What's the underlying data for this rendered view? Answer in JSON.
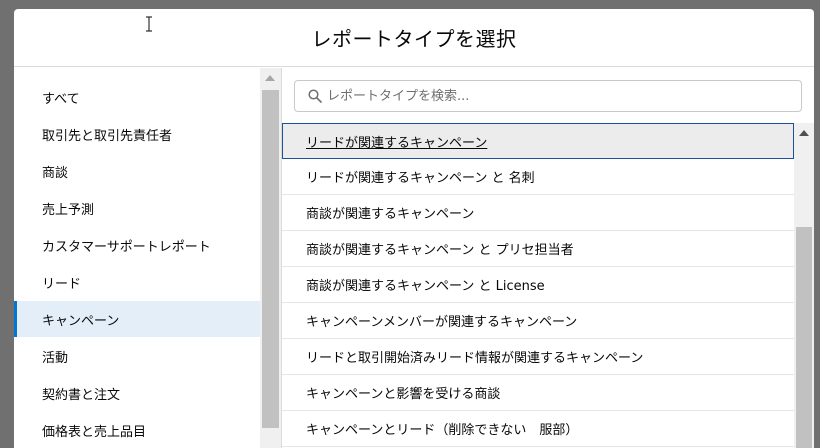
{
  "modal": {
    "title": "レポートタイプを選択"
  },
  "categories": [
    {
      "label": "すべて",
      "active": false
    },
    {
      "label": "取引先と取引先責任者",
      "active": false
    },
    {
      "label": "商談",
      "active": false
    },
    {
      "label": "売上予測",
      "active": false
    },
    {
      "label": "カスタマーサポートレポート",
      "active": false
    },
    {
      "label": "リード",
      "active": false
    },
    {
      "label": "キャンペーン",
      "active": true
    },
    {
      "label": "活動",
      "active": false
    },
    {
      "label": "契約書と注文",
      "active": false
    },
    {
      "label": "価格表と売上品目",
      "active": false
    }
  ],
  "search": {
    "placeholder": "レポートタイプを検索...",
    "value": ""
  },
  "report_types": [
    {
      "label": "リードが関連するキャンペーン",
      "selected": true
    },
    {
      "label": "リードが関連するキャンペーン と 名刺",
      "selected": false
    },
    {
      "label": "商談が関連するキャンペーン",
      "selected": false
    },
    {
      "label": "商談が関連するキャンペーン と プリセ担当者",
      "selected": false
    },
    {
      "label": "商談が関連するキャンペーン と License",
      "selected": false
    },
    {
      "label": "キャンペーンメンバーが関連するキャンペーン",
      "selected": false
    },
    {
      "label": "リードと取引開始済みリード情報が関連するキャンペーン",
      "selected": false
    },
    {
      "label": "キャンペーンと影響を受ける商談",
      "selected": false
    },
    {
      "label": "キャンペーンとリード（削除できない　服部）",
      "selected": false
    }
  ],
  "colors": {
    "accent": "#0176d3",
    "active_bg": "#e4eef9",
    "selected_border": "#1b5297",
    "overlay": "#707070"
  },
  "icons": {
    "search": "search-icon",
    "cursor": "text-cursor-icon",
    "scroll_up": "scroll-up-arrow-icon"
  }
}
